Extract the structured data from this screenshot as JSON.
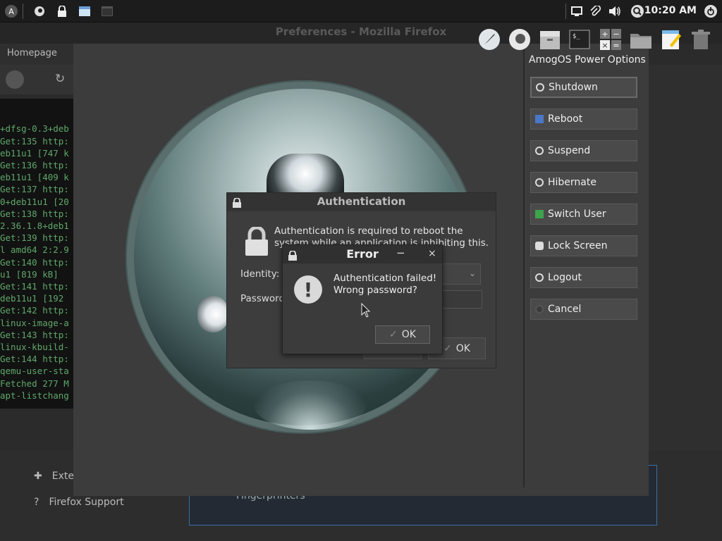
{
  "top_panel": {
    "clock": "10:20 AM",
    "icons": [
      "app-menu-icon",
      "firefox-icon",
      "lock-icon",
      "window-icon",
      "terminal-window-icon",
      "screen-icon",
      "paperclip-icon",
      "volume-icon",
      "search-icon",
      "power-icon"
    ]
  },
  "firefox": {
    "window_title": "Preferences - Mozilla Firefox",
    "tab_label": "Homepage",
    "side_links": [
      "Exte",
      "Firefox Support"
    ],
    "fingerprinters_label": "Fingerprinters"
  },
  "terminal": {
    "lines": [
      "+dfsg-0.3+deb",
      "Get:135 http:",
      "eb11u1 [747 k",
      "Get:136 http:",
      "eb11u1 [409 k",
      "Get:137 http:",
      "0+deb11u1 [20",
      "Get:138 http:",
      "2.36.1.8+deb1",
      "Get:139 http:",
      "l amd64 2:2.9",
      "Get:140 http:",
      "u1 [819 kB]",
      "Get:141 http:",
      "deb11u1 [192",
      "Get:142 http:",
      "linux-image-a",
      "Get:143 http:",
      "linux-kbuild-",
      "Get:144 http:",
      "qemu-user-sta",
      "Fetched 277 M",
      "apt-listchang"
    ]
  },
  "power_options": {
    "heading": "AmogOS Power Options",
    "buttons": [
      "Shutdown",
      "Reboot",
      "Suspend",
      "Hibernate",
      "Switch User",
      "Lock Screen",
      "Logout",
      "Cancel"
    ]
  },
  "auth_dialog": {
    "title": "Authentication",
    "message_line1": "Authentication is required to reboot the",
    "message_line2": "system while an application is inhibiting this.",
    "identity_label": "Identity:",
    "password_label": "Password",
    "ok_label": "OK"
  },
  "error_dialog": {
    "title": "Error",
    "minimize": "−",
    "close": "×",
    "icon_glyph": "!",
    "message_line1": "Authentication failed!",
    "message_line2": "Wrong password?",
    "ok_label": "OK",
    "check_glyph": "✓"
  },
  "colors": {
    "accent_blue": "#3a6fa5",
    "terminal_green": "#5fa86a",
    "panel_bg": "#1c1c1c"
  }
}
